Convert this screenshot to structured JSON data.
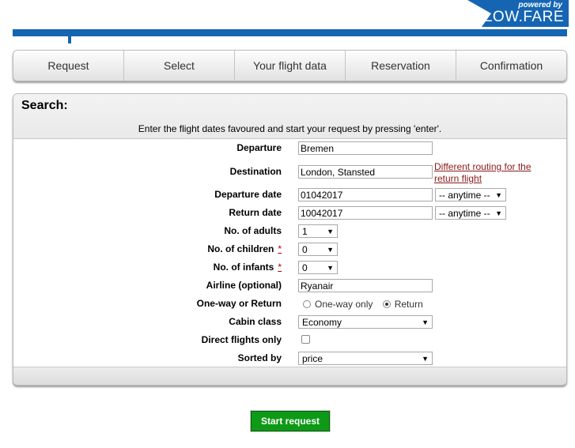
{
  "brand": {
    "powered_by": "powered by",
    "name": "LOW.FARE",
    "color": "#1565b3"
  },
  "tabs": [
    {
      "label": "Request"
    },
    {
      "label": "Select"
    },
    {
      "label": "Your flight data"
    },
    {
      "label": "Reservation"
    },
    {
      "label": "Confirmation"
    }
  ],
  "search": {
    "title": "Search:",
    "subtitle": "Enter the flight dates favoured and start your request by pressing 'enter'.",
    "departure": {
      "label": "Departure",
      "value": "Bremen"
    },
    "destination": {
      "label": "Destination",
      "value": "London, Stansted",
      "link": "Different routing for the return flight"
    },
    "departure_date": {
      "label": "Departure date",
      "value": "01042017",
      "time": "-- anytime --"
    },
    "return_date": {
      "label": "Return date",
      "value": "10042017",
      "time": "-- anytime --"
    },
    "adults": {
      "label": "No. of adults",
      "value": "1"
    },
    "children": {
      "label": "No. of children",
      "value": "0",
      "marker": "*"
    },
    "infants": {
      "label": "No. of infants",
      "value": "0",
      "marker": "*"
    },
    "airline": {
      "label": "Airline (optional)",
      "value": "Ryanair"
    },
    "trip_type": {
      "label": "One-way or Return",
      "options": [
        "One-way only",
        "Return"
      ],
      "selected": "Return"
    },
    "cabin": {
      "label": "Cabin class",
      "value": "Economy"
    },
    "direct": {
      "label": "Direct flights only",
      "checked": false
    },
    "sort": {
      "label": "Sorted by",
      "value": "price"
    }
  },
  "start_button": "Start request",
  "colors": {
    "button": "#0e9a17",
    "link": "#8b1a1a",
    "required": "#b00000"
  }
}
